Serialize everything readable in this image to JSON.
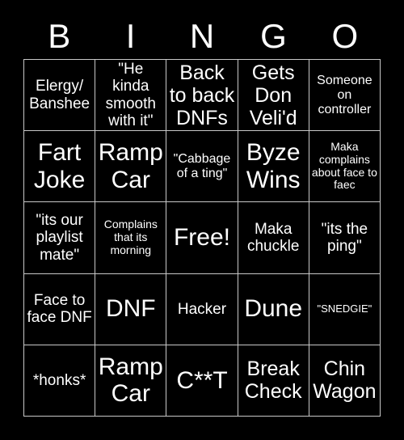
{
  "card": {
    "title_letters": [
      "B",
      "I",
      "N",
      "G",
      "O"
    ],
    "background_color": "#000000",
    "text_color": "#ffffff",
    "border_color": "#c8c8c8",
    "rows": [
      [
        {
          "text": "Elergy/ Banshee",
          "size": "md"
        },
        {
          "text": "\"He kinda smooth with it\"",
          "size": "md"
        },
        {
          "text": "Back to back DNFs",
          "size": "lg"
        },
        {
          "text": "Gets Don Veli'd",
          "size": "lg"
        },
        {
          "text": "Someone on controller",
          "size": "sm"
        }
      ],
      [
        {
          "text": "Fart Joke",
          "size": "xl"
        },
        {
          "text": "Ramp Car",
          "size": "xl"
        },
        {
          "text": "\"Cabbage of a ting\"",
          "size": "sm"
        },
        {
          "text": "Byze Wins",
          "size": "xl"
        },
        {
          "text": "Maka complains about face to faec",
          "size": "xs"
        }
      ],
      [
        {
          "text": "\"its our playlist mate\"",
          "size": "md"
        },
        {
          "text": "Complains that its morning",
          "size": "xs"
        },
        {
          "text": "Free!",
          "size": "xl"
        },
        {
          "text": "Maka chuckle",
          "size": "md"
        },
        {
          "text": "\"its the ping\"",
          "size": "md"
        }
      ],
      [
        {
          "text": "Face to face DNF",
          "size": "md"
        },
        {
          "text": "DNF",
          "size": "xl"
        },
        {
          "text": "Hacker",
          "size": "md"
        },
        {
          "text": "Dune",
          "size": "xl"
        },
        {
          "text": "\"SNEDGIE\"",
          "size": "xxs"
        }
      ],
      [
        {
          "text": "*honks*",
          "size": "md"
        },
        {
          "text": "Ramp Car",
          "size": "xl"
        },
        {
          "text": "C**T",
          "size": "xl"
        },
        {
          "text": "Break Check",
          "size": "lg"
        },
        {
          "text": "Chin Wagon",
          "size": "lg"
        }
      ]
    ]
  }
}
